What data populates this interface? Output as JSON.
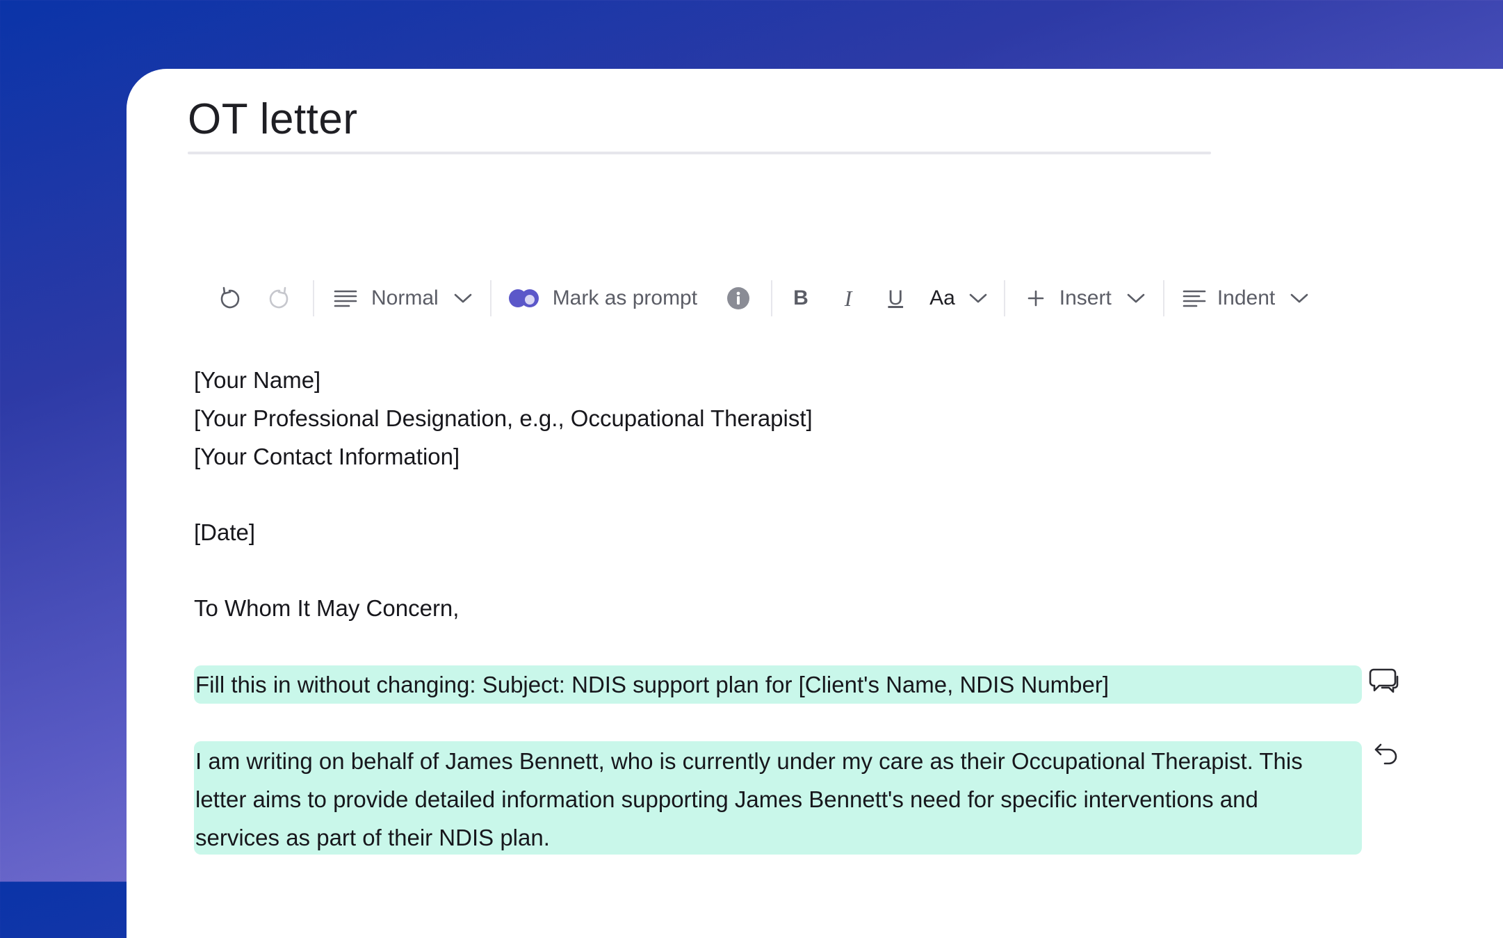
{
  "document": {
    "title": "OT letter"
  },
  "toolbar": {
    "undo_icon": "undo-icon",
    "redo_icon": "redo-icon",
    "style_select_label": "Normal",
    "mark_prompt_label": "Mark as prompt",
    "info_icon": "info-icon",
    "bold_label": "B",
    "italic_label": "I",
    "underline_label": "U",
    "font_size_label": "Aa",
    "insert_label": "Insert",
    "indent_label": "Indent"
  },
  "letter": {
    "line1": "[Your Name]",
    "line2": "[Your Professional Designation, e.g., Occupational Therapist]",
    "line3": "[Your Contact Information]",
    "date": "[Date]",
    "greeting": "To Whom It May Concern,",
    "prompt_block_1": "Fill this in without changing: Subject: NDIS support plan for [Client's Name, NDIS Number]",
    "prompt_block_2_line1": "I am writing on behalf of James Bennett, who is currently under my care as their Occupational Therapist. This",
    "prompt_block_2_line2": "letter aims to provide detailed information supporting James Bennett's need for specific interventions and",
    "prompt_block_2_line3": "services as part of their NDIS plan."
  },
  "colors": {
    "prompt_highlight": "#c9f7ea",
    "accent_purple": "#5b57c9",
    "background_gradient_start": "#0a34a8",
    "background_gradient_end": "#a58ee0"
  }
}
